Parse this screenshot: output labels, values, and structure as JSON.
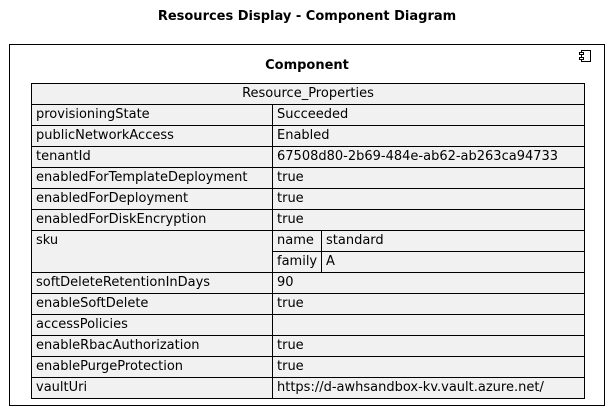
{
  "diagram": {
    "title": "Resources Display - Component Diagram",
    "component_name": "Component",
    "table_title": "Resource_Properties",
    "rows": [
      {
        "key": "provisioningState",
        "value": "Succeeded"
      },
      {
        "key": "publicNetworkAccess",
        "value": "Enabled"
      },
      {
        "key": "tenantId",
        "value": "67508d80-2b69-484e-ab62-ab263ca94733"
      },
      {
        "key": "enabledForTemplateDeployment",
        "value": "true"
      },
      {
        "key": "enabledForDeployment",
        "value": "true"
      },
      {
        "key": "enabledForDiskEncryption",
        "value": "true"
      }
    ],
    "sku": {
      "key": "sku",
      "name_key": "name",
      "name_value": "standard",
      "family_key": "family",
      "family_value": "A"
    },
    "rows_after": [
      {
        "key": "softDeleteRetentionInDays",
        "value": "90"
      },
      {
        "key": "enableSoftDelete",
        "value": "true"
      },
      {
        "key": "accessPolicies",
        "value": ""
      },
      {
        "key": "enableRbacAuthorization",
        "value": "true"
      },
      {
        "key": "enablePurgeProtection",
        "value": "true"
      },
      {
        "key": "vaultUri",
        "value": "https://d-awhsandbox-kv.vault.azure.net/"
      }
    ]
  }
}
